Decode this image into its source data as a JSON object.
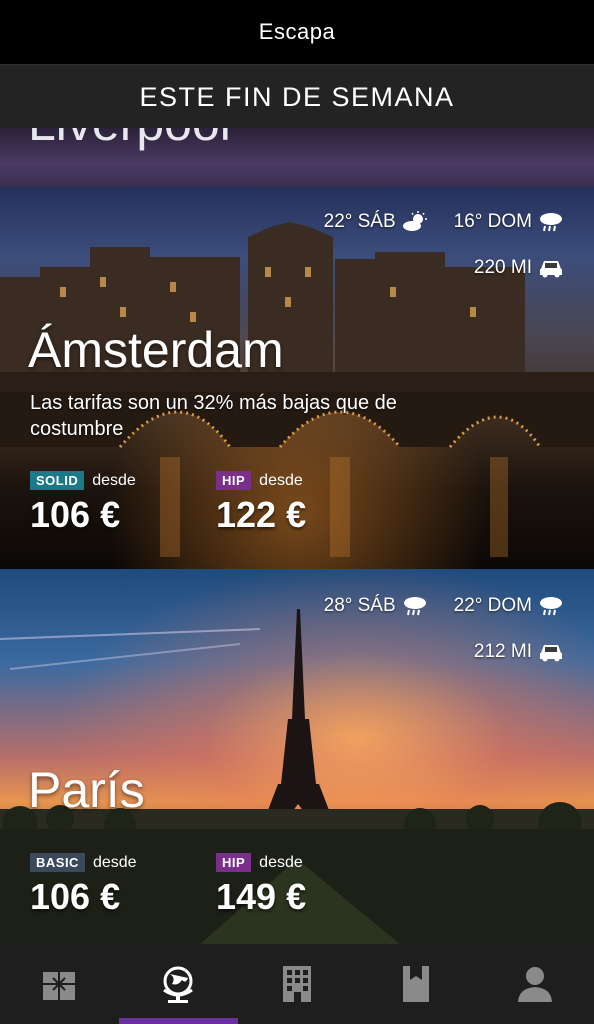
{
  "app": {
    "title": "Escapa"
  },
  "section": {
    "title": "ESTE FIN DE SEMANA"
  },
  "previous_card": {
    "city": "Liverpool"
  },
  "cards": [
    {
      "city": "Ámsterdam",
      "weather": [
        {
          "text": "22° SÁB",
          "icon": "partly-sunny-icon"
        },
        {
          "text": "16° DOM",
          "icon": "rain-icon"
        }
      ],
      "distance": {
        "text": "220 MI",
        "icon": "car-icon"
      },
      "description": "Las tarifas son un 32% más bajas que de costumbre",
      "prices": [
        {
          "badge": "SOLID",
          "badge_color": "#1b7a86",
          "from": "desde",
          "amount": "106 €"
        },
        {
          "badge": "HIP",
          "badge_color": "#7a2f8a",
          "from": "desde",
          "amount": "122 €"
        }
      ]
    },
    {
      "city": "París",
      "weather": [
        {
          "text": "28° SÁB",
          "icon": "rain-icon"
        },
        {
          "text": "22° DOM",
          "icon": "rain-icon"
        }
      ],
      "distance": {
        "text": "212 MI",
        "icon": "car-icon"
      },
      "prices": [
        {
          "badge": "BASIC",
          "badge_color": "#3a4a5c",
          "from": "desde",
          "amount": "106 €"
        },
        {
          "badge": "HIP",
          "badge_color": "#7a2f8a",
          "from": "desde",
          "amount": "149 €"
        }
      ]
    }
  ],
  "nav": {
    "items": [
      {
        "icon": "gift-icon",
        "active": false
      },
      {
        "icon": "globe-icon",
        "active": true
      },
      {
        "icon": "hotel-icon",
        "active": false
      },
      {
        "icon": "bookmark-icon",
        "active": false
      },
      {
        "icon": "profile-icon",
        "active": false
      }
    ],
    "accent_color": "#6a2fa0"
  }
}
